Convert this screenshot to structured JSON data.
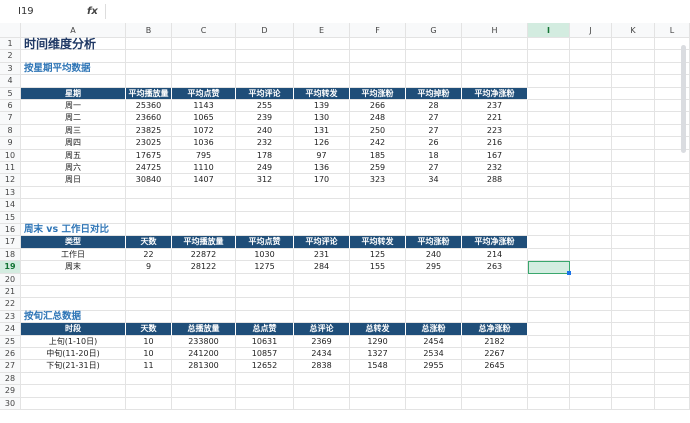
{
  "formula_bar": {
    "name_box": "I19",
    "fx_label": "fx",
    "value": ""
  },
  "columns": [
    "A",
    "B",
    "C",
    "D",
    "E",
    "F",
    "G",
    "H",
    "I",
    "J",
    "K",
    "L"
  ],
  "rows": [
    "1",
    "2",
    "3",
    "4",
    "5",
    "6",
    "7",
    "8",
    "9",
    "10",
    "11",
    "12",
    "13",
    "14",
    "15",
    "16",
    "17",
    "18",
    "19",
    "20",
    "21",
    "22",
    "23",
    "24",
    "25",
    "26",
    "27",
    "28",
    "29",
    "30"
  ],
  "selected_cell": "I19",
  "colors": {
    "header_fill": "#1f4e79",
    "title": "#1f3864",
    "section": "#2e75b6",
    "selection": "#b7e1cd"
  },
  "title": "时间维度分析",
  "weekday": {
    "heading": "按星期平均数据",
    "headers": [
      "星期",
      "平均播放量",
      "平均点赞",
      "平均评论",
      "平均转发",
      "平均涨粉",
      "平均掉粉",
      "平均净涨粉"
    ],
    "rows": [
      [
        "周一",
        "25360",
        "1143",
        "255",
        "139",
        "266",
        "28",
        "237"
      ],
      [
        "周二",
        "23660",
        "1065",
        "239",
        "130",
        "248",
        "27",
        "221"
      ],
      [
        "周三",
        "23825",
        "1072",
        "240",
        "131",
        "250",
        "27",
        "223"
      ],
      [
        "周四",
        "23025",
        "1036",
        "232",
        "126",
        "242",
        "26",
        "216"
      ],
      [
        "周五",
        "17675",
        "795",
        "178",
        "97",
        "185",
        "18",
        "167"
      ],
      [
        "周六",
        "24725",
        "1110",
        "249",
        "136",
        "259",
        "27",
        "232"
      ],
      [
        "周日",
        "30840",
        "1407",
        "312",
        "170",
        "323",
        "34",
        "288"
      ]
    ]
  },
  "weekend": {
    "heading": "周末 vs 工作日对比",
    "headers": [
      "类型",
      "天数",
      "平均播放量",
      "平均点赞",
      "平均评论",
      "平均转发",
      "平均涨粉",
      "平均净涨粉"
    ],
    "rows": [
      [
        "工作日",
        "22",
        "22872",
        "1030",
        "231",
        "125",
        "240",
        "214"
      ],
      [
        "周末",
        "9",
        "28122",
        "1275",
        "284",
        "155",
        "295",
        "263"
      ]
    ]
  },
  "tenday": {
    "heading": "按旬汇总数据",
    "headers": [
      "时段",
      "天数",
      "总播放量",
      "总点赞",
      "总评论",
      "总转发",
      "总涨粉",
      "总净涨粉"
    ],
    "rows": [
      [
        "上旬(1-10日)",
        "10",
        "233800",
        "10631",
        "2369",
        "1290",
        "2454",
        "2182"
      ],
      [
        "中旬(11-20日)",
        "10",
        "241200",
        "10857",
        "2434",
        "1327",
        "2534",
        "2267"
      ],
      [
        "下旬(21-31日)",
        "11",
        "281300",
        "12652",
        "2838",
        "1548",
        "2955",
        "2645"
      ]
    ]
  }
}
